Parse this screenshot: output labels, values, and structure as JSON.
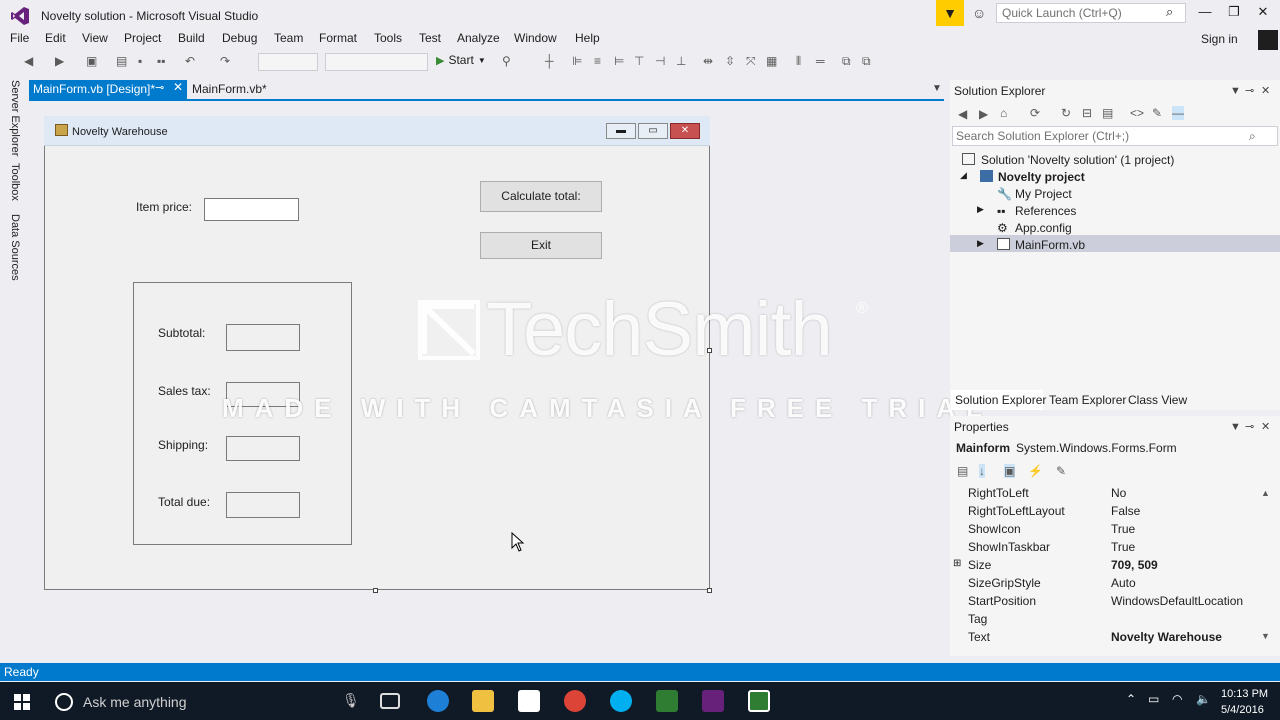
{
  "window": {
    "title": "Novelty solution - Microsoft Visual Studio",
    "quick_launch_placeholder": "Quick Launch (Ctrl+Q)",
    "sign_in": "Sign in"
  },
  "menu": [
    "File",
    "Edit",
    "View",
    "Project",
    "Build",
    "Debug",
    "Team",
    "Format",
    "Tools",
    "Test",
    "Analyze",
    "Window",
    "Help"
  ],
  "toolbar": {
    "start_label": "Start"
  },
  "left_strip": [
    "Server Explorer",
    "Toolbox",
    "Data Sources"
  ],
  "doc_tabs": [
    {
      "label": "MainForm.vb [Design]*",
      "active": true
    },
    {
      "label": "MainForm.vb*",
      "active": false
    }
  ],
  "form": {
    "title": "Novelty Warehouse",
    "item_price_label": "Item price:",
    "calculate_button": "Calculate total:",
    "exit_button": "Exit",
    "subtotal_label": "Subtotal:",
    "sales_tax_label": "Sales tax:",
    "shipping_label": "Shipping:",
    "total_due_label": "Total due:"
  },
  "watermark": {
    "brand": "TechSmith",
    "registered": "®",
    "tagline": "MADE WITH CAMTASIA FREE TRIAL"
  },
  "solution_explorer": {
    "title": "Solution Explorer",
    "search_placeholder": "Search Solution Explorer (Ctrl+;)",
    "tree": [
      {
        "label": "Solution 'Novelty solution' (1 project)",
        "level": 0,
        "bold": false
      },
      {
        "label": "Novelty project",
        "level": 1,
        "bold": true
      },
      {
        "label": "My Project",
        "level": 2,
        "bold": false
      },
      {
        "label": "References",
        "level": 2,
        "bold": false
      },
      {
        "label": "App.config",
        "level": 2,
        "bold": false
      },
      {
        "label": "MainForm.vb",
        "level": 2,
        "bold": false,
        "selected": true
      }
    ],
    "bottom_tabs": [
      "Solution Explorer",
      "Team Explorer",
      "Class View"
    ]
  },
  "properties": {
    "title": "Properties",
    "object_name": "Mainform",
    "object_type": "System.Windows.Forms.Form",
    "rows": [
      {
        "name": "RightToLeft",
        "value": "No",
        "bold": false
      },
      {
        "name": "RightToLeftLayout",
        "value": "False",
        "bold": false
      },
      {
        "name": "ShowIcon",
        "value": "True",
        "bold": false
      },
      {
        "name": "ShowInTaskbar",
        "value": "True",
        "bold": false
      },
      {
        "name": "Size",
        "value": "709, 509",
        "bold": true,
        "expandable": true
      },
      {
        "name": "SizeGripStyle",
        "value": "Auto",
        "bold": false
      },
      {
        "name": "StartPosition",
        "value": "WindowsDefaultLocation",
        "bold": false
      },
      {
        "name": "Tag",
        "value": "",
        "bold": false
      },
      {
        "name": "Text",
        "value": "Novelty Warehouse",
        "bold": true
      }
    ]
  },
  "status": {
    "text": "Ready"
  },
  "taskbar": {
    "search_placeholder": "Ask me anything",
    "time": "10:13 PM",
    "date": "5/4/2016"
  },
  "colors": {
    "accent": "#007acc",
    "chrome": "#eeeef2",
    "taskbar": "#101a26",
    "filter_yellow": "#ffcc00"
  }
}
